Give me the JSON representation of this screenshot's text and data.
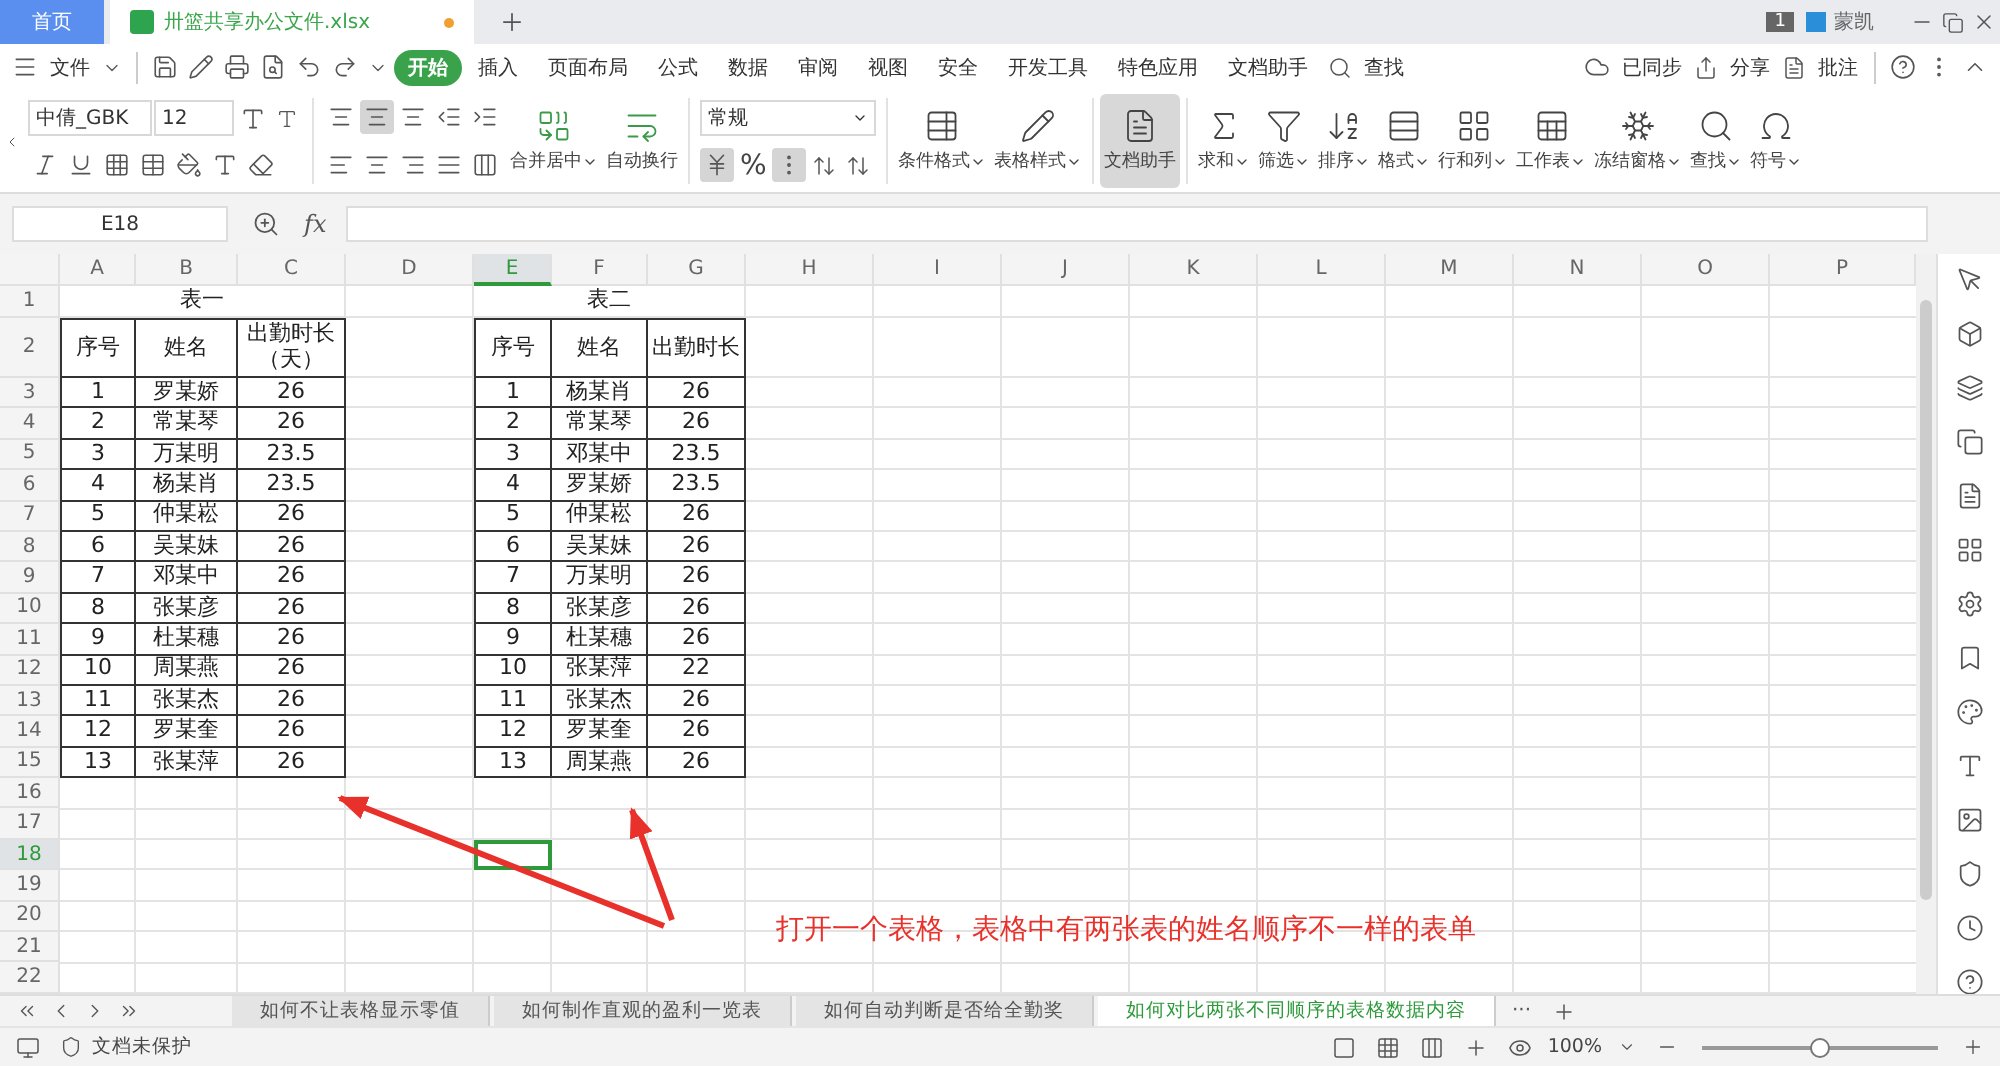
{
  "title_tabs": [
    {
      "label": "首页",
      "kind": "home"
    },
    {
      "label": "卅篮共享办公文件.xlsx",
      "kind": "file"
    }
  ],
  "account": {
    "badge": "1",
    "name": "蒙凯"
  },
  "menu": {
    "file": "文件",
    "tabs": [
      {
        "label": "开始",
        "selected": true
      },
      {
        "label": "插入",
        "selected": false
      },
      {
        "label": "页面布局",
        "selected": false
      },
      {
        "label": "公式",
        "selected": false
      },
      {
        "label": "数据",
        "selected": false
      },
      {
        "label": "审阅",
        "selected": false
      },
      {
        "label": "视图",
        "selected": false
      },
      {
        "label": "安全",
        "selected": false
      },
      {
        "label": "开发工具",
        "selected": false
      },
      {
        "label": "特色应用",
        "selected": false
      },
      {
        "label": "文档助手",
        "selected": false
      }
    ],
    "search": "查找",
    "right": [
      "已同步",
      "分享",
      "批注"
    ]
  },
  "ribbon": {
    "font_name": "中倩_GBK",
    "font_size": "12",
    "align_buttons": [
      {
        "selected": false
      },
      {
        "selected": true
      },
      {
        "selected": false
      },
      {
        "selected": false
      },
      {
        "selected": false
      },
      {
        "selected": false
      },
      {
        "selected": false
      },
      {
        "selected": false
      },
      {
        "selected": false
      },
      {
        "selected": false
      }
    ],
    "merge_buttons": [
      {
        "label": "合并居中",
        "menu": true
      },
      {
        "label": "自动换行",
        "menu": false
      }
    ],
    "number_format": "常规",
    "currency_selected": true,
    "percent": "%",
    "thousands_selected": true,
    "buttons": [
      {
        "label": "条件格式",
        "menu": true,
        "selected": false
      },
      {
        "label": "表格样式",
        "menu": true,
        "selected": false
      },
      {
        "label": "文档助手",
        "menu": false,
        "selected": true
      },
      {
        "label": "求和",
        "menu": true,
        "selected": false
      },
      {
        "label": "筛选",
        "menu": true,
        "selected": false
      },
      {
        "label": "排序",
        "menu": true,
        "selected": false
      },
      {
        "label": "格式",
        "menu": true,
        "selected": false
      },
      {
        "label": "行和列",
        "menu": true,
        "selected": false
      },
      {
        "label": "工作表",
        "menu": true,
        "selected": false
      },
      {
        "label": "冻结窗格",
        "menu": true,
        "selected": false
      },
      {
        "label": "查找",
        "menu": true,
        "selected": false
      },
      {
        "label": "符号",
        "menu": true,
        "selected": false
      }
    ]
  },
  "formula_bar": {
    "cell": "E18",
    "fx": "fx"
  },
  "column_headers": [
    {
      "label": "A",
      "selected": false
    },
    {
      "label": "B",
      "selected": false
    },
    {
      "label": "C",
      "selected": false
    },
    {
      "label": "D",
      "selected": false
    },
    {
      "label": "E",
      "selected": true
    },
    {
      "label": "F",
      "selected": false
    },
    {
      "label": "G",
      "selected": false
    },
    {
      "label": "H",
      "selected": false
    },
    {
      "label": "I",
      "selected": false
    },
    {
      "label": "J",
      "selected": false
    },
    {
      "label": "K",
      "selected": false
    },
    {
      "label": "L",
      "selected": false
    },
    {
      "label": "M",
      "selected": false
    },
    {
      "label": "N",
      "selected": false
    },
    {
      "label": "O",
      "selected": false
    },
    {
      "label": "P",
      "selected": false
    }
  ],
  "row_headers": [
    {
      "label": "1",
      "selected": false
    },
    {
      "label": "2",
      "selected": false
    },
    {
      "label": "3",
      "selected": false
    },
    {
      "label": "4",
      "selected": false
    },
    {
      "label": "5",
      "selected": false
    },
    {
      "label": "6",
      "selected": false
    },
    {
      "label": "7",
      "selected": false
    },
    {
      "label": "8",
      "selected": false
    },
    {
      "label": "9",
      "selected": false
    },
    {
      "label": "10",
      "selected": false
    },
    {
      "label": "11",
      "selected": false
    },
    {
      "label": "12",
      "selected": false
    },
    {
      "label": "13",
      "selected": false
    },
    {
      "label": "14",
      "selected": false
    },
    {
      "label": "15",
      "selected": false
    },
    {
      "label": "16",
      "selected": false
    },
    {
      "label": "17",
      "selected": false
    },
    {
      "label": "18",
      "selected": true
    },
    {
      "label": "19",
      "selected": false
    },
    {
      "label": "20",
      "selected": false
    },
    {
      "label": "21",
      "selected": false
    },
    {
      "label": "22",
      "selected": false
    }
  ],
  "tables": [
    {
      "title": "表一",
      "headers": [
        "序号",
        "姓名",
        "出勤时长（天）"
      ],
      "rows": [
        [
          "1",
          "罗某娇",
          "26"
        ],
        [
          "2",
          "常某琴",
          "26"
        ],
        [
          "3",
          "万某明",
          "23.5"
        ],
        [
          "4",
          "杨某肖",
          "23.5"
        ],
        [
          "5",
          "仲某崧",
          "26"
        ],
        [
          "6",
          "吴某妹",
          "26"
        ],
        [
          "7",
          "邓某中",
          "26"
        ],
        [
          "8",
          "张某彦",
          "26"
        ],
        [
          "9",
          "杜某穗",
          "26"
        ],
        [
          "10",
          "周某燕",
          "26"
        ],
        [
          "11",
          "张某杰",
          "26"
        ],
        [
          "12",
          "罗某奎",
          "26"
        ],
        [
          "13",
          "张某萍",
          "26"
        ]
      ]
    },
    {
      "title": "表二",
      "headers": [
        "序号",
        "姓名",
        "出勤时长"
      ],
      "rows": [
        [
          "1",
          "杨某肖",
          "26"
        ],
        [
          "2",
          "常某琴",
          "26"
        ],
        [
          "3",
          "邓某中",
          "23.5"
        ],
        [
          "4",
          "罗某娇",
          "23.5"
        ],
        [
          "5",
          "仲某崧",
          "26"
        ],
        [
          "6",
          "吴某妹",
          "26"
        ],
        [
          "7",
          "万某明",
          "26"
        ],
        [
          "8",
          "张某彦",
          "26"
        ],
        [
          "9",
          "杜某穗",
          "26"
        ],
        [
          "10",
          "张某萍",
          "22"
        ],
        [
          "11",
          "张某杰",
          "26"
        ],
        [
          "12",
          "罗某奎",
          "26"
        ],
        [
          "13",
          "周某燕",
          "26"
        ]
      ]
    }
  ],
  "annotation": "打开一个表格，表格中有两张表的姓名顺序不一样的表单",
  "sheet_tabs": [
    {
      "label": "如何不让表格显示零值",
      "selected": false
    },
    {
      "label": "如何制作直观的盈利一览表",
      "selected": false
    },
    {
      "label": "如何自动判断是否给全勤奖",
      "selected": false
    },
    {
      "label": "如何对比两张不同顺序的表格数据内容",
      "selected": true
    }
  ],
  "sheet_more": "···",
  "status_bar": {
    "protection": "文档未保护",
    "zoom": "100%",
    "zoom_slider": {
      "level": 0.5
    }
  }
}
